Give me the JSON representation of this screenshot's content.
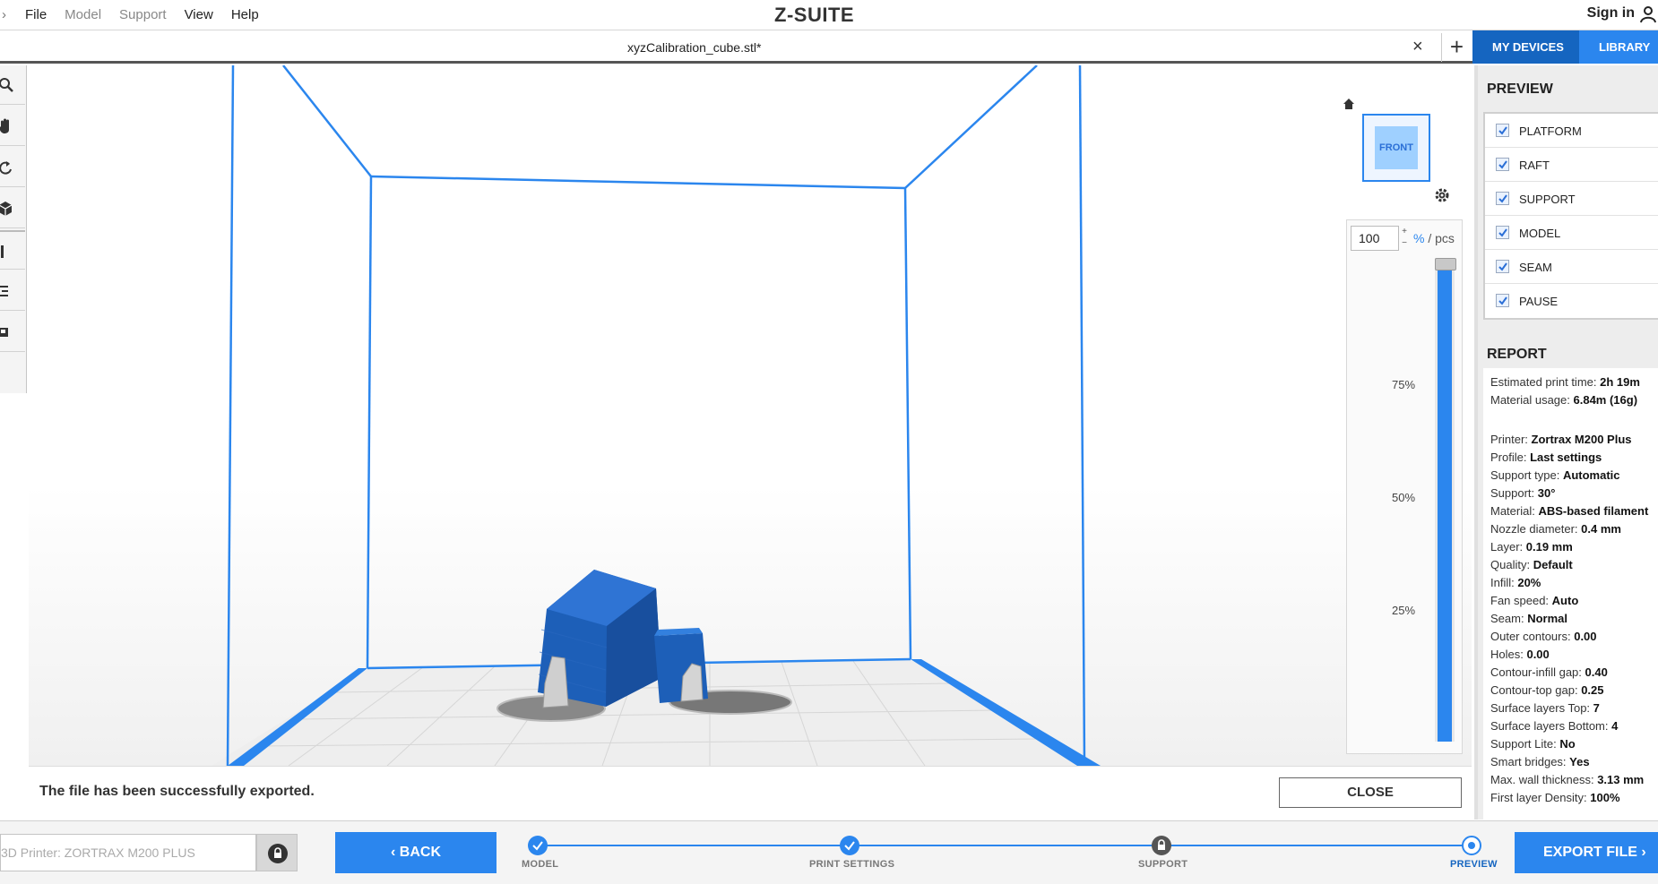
{
  "menu": {
    "items": [
      "File",
      "Model",
      "Support",
      "View",
      "Help"
    ],
    "logo": "Z-SUITE",
    "signin": "Sign in"
  },
  "tab": {
    "title": "xyzCalibration_cube.stl*",
    "close": "×",
    "add": "+"
  },
  "device_tabs": {
    "my_devices": "MY DEVICES",
    "library": "LIBRARY"
  },
  "viewport": {
    "view_cube_label": "FRONT",
    "layer_value": "100",
    "stepper_up": "+",
    "stepper_down": "−",
    "unit_pct": "%",
    "unit_sep": " / pcs",
    "ticks": [
      "75%",
      "50%",
      "25%"
    ],
    "layer_fill_fraction": 1.0
  },
  "notification": {
    "message": "The file has been successfully exported.",
    "close_label": "CLOSE"
  },
  "preview": {
    "title": "PREVIEW",
    "items": [
      {
        "label": "PLATFORM",
        "checked": true,
        "color": ""
      },
      {
        "label": "RAFT",
        "checked": true,
        "color": "#a6a6a6"
      },
      {
        "label": "SUPPORT",
        "checked": true,
        "color": "#e4e4e4"
      },
      {
        "label": "MODEL",
        "checked": true,
        "color": "#2b86ee"
      },
      {
        "label": "SEAM",
        "checked": true,
        "color": "#0b5d8a"
      },
      {
        "label": "PAUSE",
        "checked": true,
        "color": "#d32020"
      }
    ]
  },
  "report": {
    "title": "REPORT",
    "group1": [
      {
        "k": "Estimated print time: ",
        "v": "2h 19m"
      },
      {
        "k": "Material usage: ",
        "v": "6.84m (16g)"
      }
    ],
    "group2": [
      {
        "k": "Printer: ",
        "v": "Zortrax M200 Plus"
      },
      {
        "k": "Profile: ",
        "v": "Last settings"
      },
      {
        "k": "Support type: ",
        "v": "Automatic"
      },
      {
        "k": "Support: ",
        "v": "30°"
      },
      {
        "k": "Material: ",
        "v": "ABS-based filament"
      },
      {
        "k": "Nozzle diameter: ",
        "v": "0.4 mm"
      },
      {
        "k": "Layer: ",
        "v": "0.19 mm"
      },
      {
        "k": "Quality: ",
        "v": "Default"
      },
      {
        "k": "Infill: ",
        "v": "20%"
      },
      {
        "k": "Fan speed: ",
        "v": "Auto"
      },
      {
        "k": "Seam: ",
        "v": "Normal"
      },
      {
        "k": "Outer contours: ",
        "v": "0.00"
      },
      {
        "k": "Holes: ",
        "v": "0.00"
      },
      {
        "k": "Contour-infill gap: ",
        "v": "0.40"
      },
      {
        "k": "Contour-top gap: ",
        "v": "0.25"
      },
      {
        "k": "Surface layers Top: ",
        "v": "7"
      },
      {
        "k": "Surface layers Bottom: ",
        "v": "4"
      },
      {
        "k": "Support Lite: ",
        "v": "No"
      },
      {
        "k": "Smart bridges: ",
        "v": "Yes"
      },
      {
        "k": "Max. wall thickness: ",
        "v": "3.13 mm"
      },
      {
        "k": "First layer Density: ",
        "v": "100%"
      }
    ]
  },
  "bottom": {
    "printer_placeholder": "3D Printer: ZORTRAX M200 PLUS",
    "back_label": "BACK",
    "export_label": "EXPORT FILE",
    "steps": [
      {
        "label": "MODEL",
        "state": "done"
      },
      {
        "label": "PRINT SETTINGS",
        "state": "done"
      },
      {
        "label": "SUPPORT",
        "state": "locked"
      },
      {
        "label": "PREVIEW",
        "state": "current"
      }
    ]
  }
}
